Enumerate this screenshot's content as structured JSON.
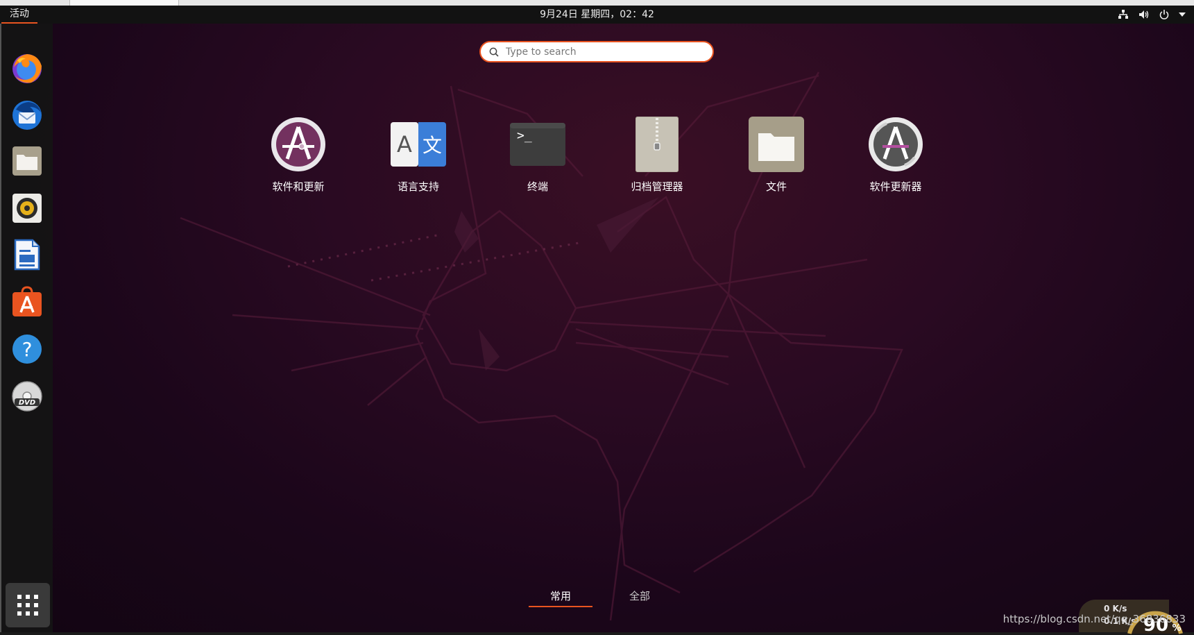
{
  "topbar": {
    "activities": "活动",
    "clock": "9月24日 星期四，02：42",
    "tray_icons": [
      "network-icon",
      "volume-icon",
      "power-icon",
      "menu-arrow-icon"
    ]
  },
  "dock": {
    "items": [
      {
        "name": "firefox",
        "icon": "firefox-icon"
      },
      {
        "name": "thunderbird",
        "icon": "thunderbird-icon"
      },
      {
        "name": "files",
        "icon": "files-icon"
      },
      {
        "name": "rhythmbox",
        "icon": "speaker-icon"
      },
      {
        "name": "libreoffice-writer",
        "icon": "writer-icon"
      },
      {
        "name": "ubuntu-software",
        "icon": "software-center-icon"
      },
      {
        "name": "help",
        "icon": "help-icon"
      },
      {
        "name": "dvd",
        "icon": "dvd-icon"
      }
    ],
    "show_apps_icon": "app-grid-icon"
  },
  "search": {
    "placeholder": "Type to search"
  },
  "apps": [
    {
      "label": "软件和更新",
      "icon": "software-properties-icon"
    },
    {
      "label": "语言支持",
      "icon": "language-support-icon"
    },
    {
      "label": "终端",
      "icon": "terminal-icon"
    },
    {
      "label": "归档管理器",
      "icon": "archive-manager-icon"
    },
    {
      "label": "文件",
      "icon": "folder-icon"
    },
    {
      "label": "软件更新器",
      "icon": "software-updater-icon"
    }
  ],
  "tabs": {
    "frequent": "常用",
    "all": "全部"
  },
  "overlay": {
    "watermark": "https://blog.csdn.net/qq_36836833",
    "net_up": "0 K/s",
    "net_down": "0.1 K/s",
    "gauge_value": "90",
    "gauge_unit": "%"
  },
  "colors": {
    "accent": "#e95420",
    "aubergine": "#2c0a23"
  }
}
